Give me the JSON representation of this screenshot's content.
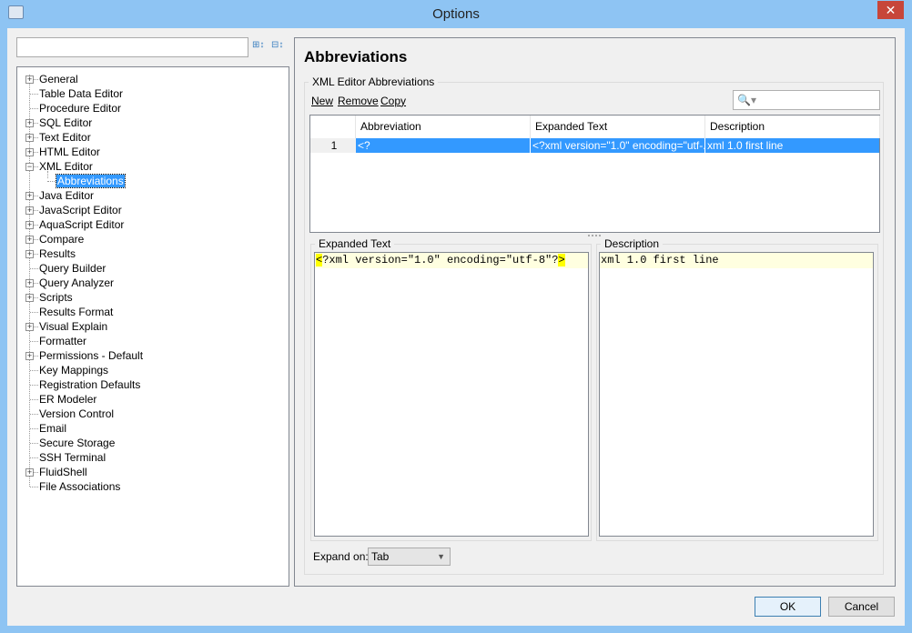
{
  "window": {
    "title": "Options",
    "close": "✕"
  },
  "tree": {
    "items": [
      {
        "label": "General",
        "expandable": true,
        "level": 0
      },
      {
        "label": "Table Data Editor",
        "expandable": false,
        "level": 0
      },
      {
        "label": "Procedure Editor",
        "expandable": false,
        "level": 0
      },
      {
        "label": "SQL Editor",
        "expandable": true,
        "level": 0
      },
      {
        "label": "Text Editor",
        "expandable": true,
        "level": 0
      },
      {
        "label": "HTML Editor",
        "expandable": true,
        "level": 0
      },
      {
        "label": "XML Editor",
        "expandable": true,
        "expanded": true,
        "level": 0
      },
      {
        "label": "Abbreviations",
        "expandable": false,
        "level": 1,
        "selected": true
      },
      {
        "label": "Java Editor",
        "expandable": true,
        "level": 0
      },
      {
        "label": "JavaScript Editor",
        "expandable": true,
        "level": 0
      },
      {
        "label": "AquaScript Editor",
        "expandable": true,
        "level": 0
      },
      {
        "label": "Compare",
        "expandable": true,
        "level": 0
      },
      {
        "label": "Results",
        "expandable": true,
        "level": 0
      },
      {
        "label": "Query Builder",
        "expandable": false,
        "level": 0
      },
      {
        "label": "Query Analyzer",
        "expandable": true,
        "level": 0
      },
      {
        "label": "Scripts",
        "expandable": true,
        "level": 0
      },
      {
        "label": "Results Format",
        "expandable": false,
        "level": 0
      },
      {
        "label": "Visual Explain",
        "expandable": true,
        "level": 0
      },
      {
        "label": "Formatter",
        "expandable": false,
        "level": 0
      },
      {
        "label": "Permissions - Default",
        "expandable": true,
        "level": 0
      },
      {
        "label": "Key Mappings",
        "expandable": false,
        "level": 0
      },
      {
        "label": "Registration Defaults",
        "expandable": false,
        "level": 0
      },
      {
        "label": "ER Modeler",
        "expandable": false,
        "level": 0
      },
      {
        "label": "Version Control",
        "expandable": false,
        "level": 0
      },
      {
        "label": "Email",
        "expandable": false,
        "level": 0
      },
      {
        "label": "Secure Storage",
        "expandable": false,
        "level": 0
      },
      {
        "label": "SSH Terminal",
        "expandable": false,
        "level": 0
      },
      {
        "label": "FluidShell",
        "expandable": true,
        "level": 0
      },
      {
        "label": "File Associations",
        "expandable": false,
        "level": 0
      }
    ]
  },
  "page": {
    "title": "Abbreviations",
    "group": "XML Editor Abbreviations",
    "actions": {
      "new": "New",
      "remove": "Remove",
      "copy": "Copy"
    },
    "filter_icon": "🔍▾",
    "table": {
      "columns": [
        "Abbreviation",
        "Expanded Text",
        "Description"
      ],
      "rows": [
        {
          "num": "1",
          "abbreviation": "<?",
          "expanded": "<?xml version=\"1.0\" encoding=\"utf-...",
          "description": "xml 1.0 first line"
        }
      ]
    },
    "expanded_text": {
      "label": "Expanded Text",
      "pre": "<",
      "mid": "?xml version=\"1.0\" encoding=\"utf-8\"?",
      "post": ">"
    },
    "description": {
      "label": "Description",
      "value": "xml 1.0 first line"
    },
    "expand_on": {
      "label": "Expand on:",
      "value": "Tab"
    }
  },
  "buttons": {
    "ok": "OK",
    "cancel": "Cancel"
  }
}
